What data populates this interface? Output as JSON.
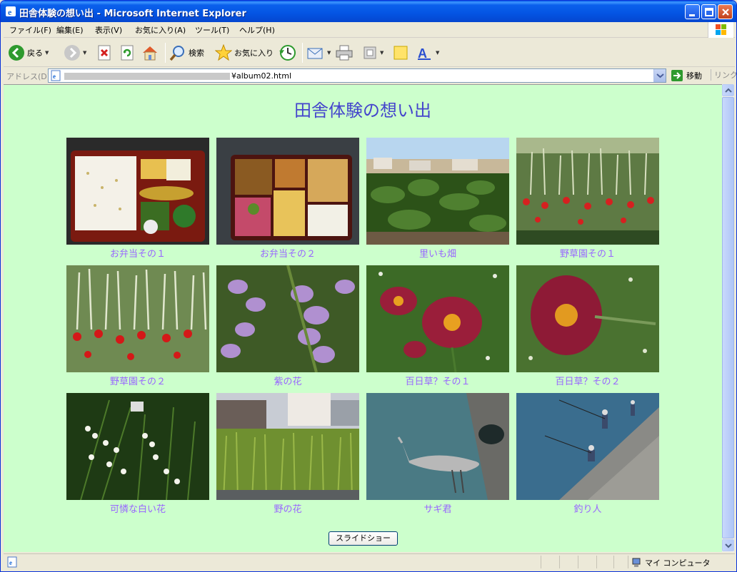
{
  "window": {
    "title": "田舎体験の想い出 - Microsoft Internet Explorer"
  },
  "menu": {
    "items": [
      "ファイル(F)",
      "編集(E)",
      "表示(V)",
      "お気に入り(A)",
      "ツール(T)",
      "ヘルプ(H)"
    ]
  },
  "toolbar": {
    "back_label": "戻る",
    "search_label": "検索",
    "favorites_label": "お気に入り"
  },
  "address": {
    "label": "アドレス(D)",
    "url_visible": "¥album02.html",
    "go_label": "移動",
    "links_label": "リンク"
  },
  "page": {
    "title": "田舎体験の想い出",
    "photos": [
      {
        "caption": "お弁当その１",
        "scene": "bento-rice"
      },
      {
        "caption": "お弁当その２",
        "scene": "bento-mixed"
      },
      {
        "caption": "里いも畑",
        "scene": "taro-field"
      },
      {
        "caption": "野草園その１",
        "scene": "wild-garden-1"
      },
      {
        "caption": "野草園その２",
        "scene": "wild-garden-2"
      },
      {
        "caption": "紫の花",
        "scene": "purple-flower"
      },
      {
        "caption": "百日草？その１",
        "scene": "zinnia-1"
      },
      {
        "caption": "百日草？その２",
        "scene": "zinnia-2"
      },
      {
        "caption": "可憐な白い花",
        "scene": "white-flowers"
      },
      {
        "caption": "野の花",
        "scene": "field-flowers"
      },
      {
        "caption": "サギ君",
        "scene": "heron"
      },
      {
        "caption": "釣り人",
        "scene": "anglers"
      }
    ],
    "slideshow_button": "スライドショー"
  },
  "status": {
    "zone_label": "マイ コンピュータ"
  },
  "colors": {
    "page_bg": "#ccffcc",
    "title_color": "#4444cc",
    "caption_color": "#9966ff"
  }
}
